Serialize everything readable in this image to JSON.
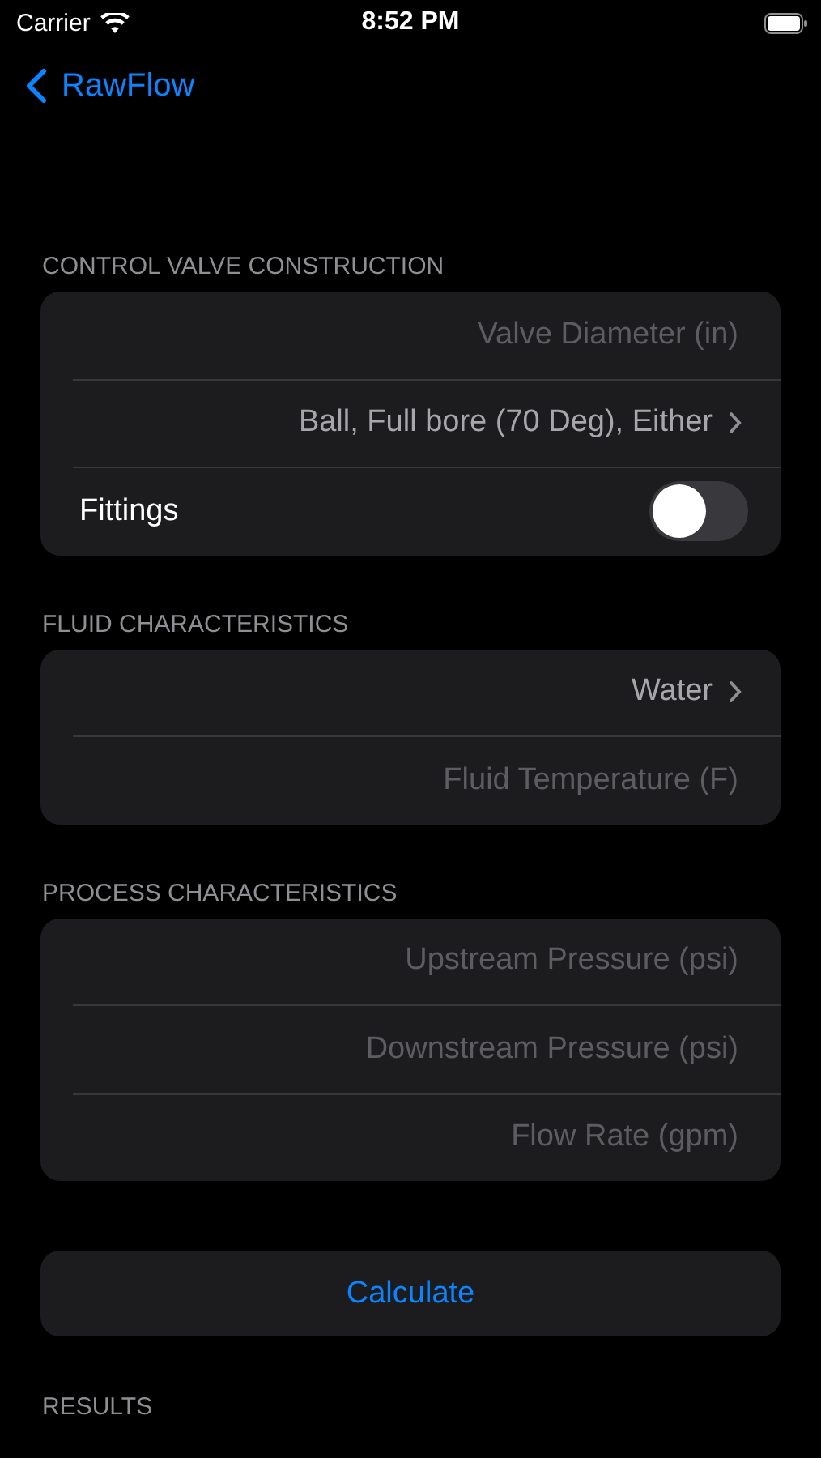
{
  "status_bar": {
    "carrier": "Carrier",
    "time": "8:52 PM"
  },
  "nav": {
    "back_label": "RawFlow"
  },
  "sections": [
    {
      "header": "CONTROL VALVE CONSTRUCTION",
      "rows": [
        {
          "kind": "field",
          "placeholder": "Valve Diameter (in)"
        },
        {
          "kind": "picker",
          "value": "Ball, Full bore (70 Deg), Either"
        },
        {
          "kind": "toggle",
          "label": "Fittings",
          "on": false
        }
      ]
    },
    {
      "header": "FLUID CHARACTERISTICS",
      "rows": [
        {
          "kind": "picker",
          "value": "Water"
        },
        {
          "kind": "field",
          "placeholder": "Fluid Temperature (F)"
        }
      ]
    },
    {
      "header": "PROCESS CHARACTERISTICS",
      "rows": [
        {
          "kind": "field",
          "placeholder": "Upstream Pressure (psi)"
        },
        {
          "kind": "field",
          "placeholder": "Downstream Pressure (psi)"
        },
        {
          "kind": "field",
          "placeholder": "Flow Rate (gpm)"
        }
      ]
    }
  ],
  "calculate_button": "Calculate",
  "results_header": "RESULTS"
}
